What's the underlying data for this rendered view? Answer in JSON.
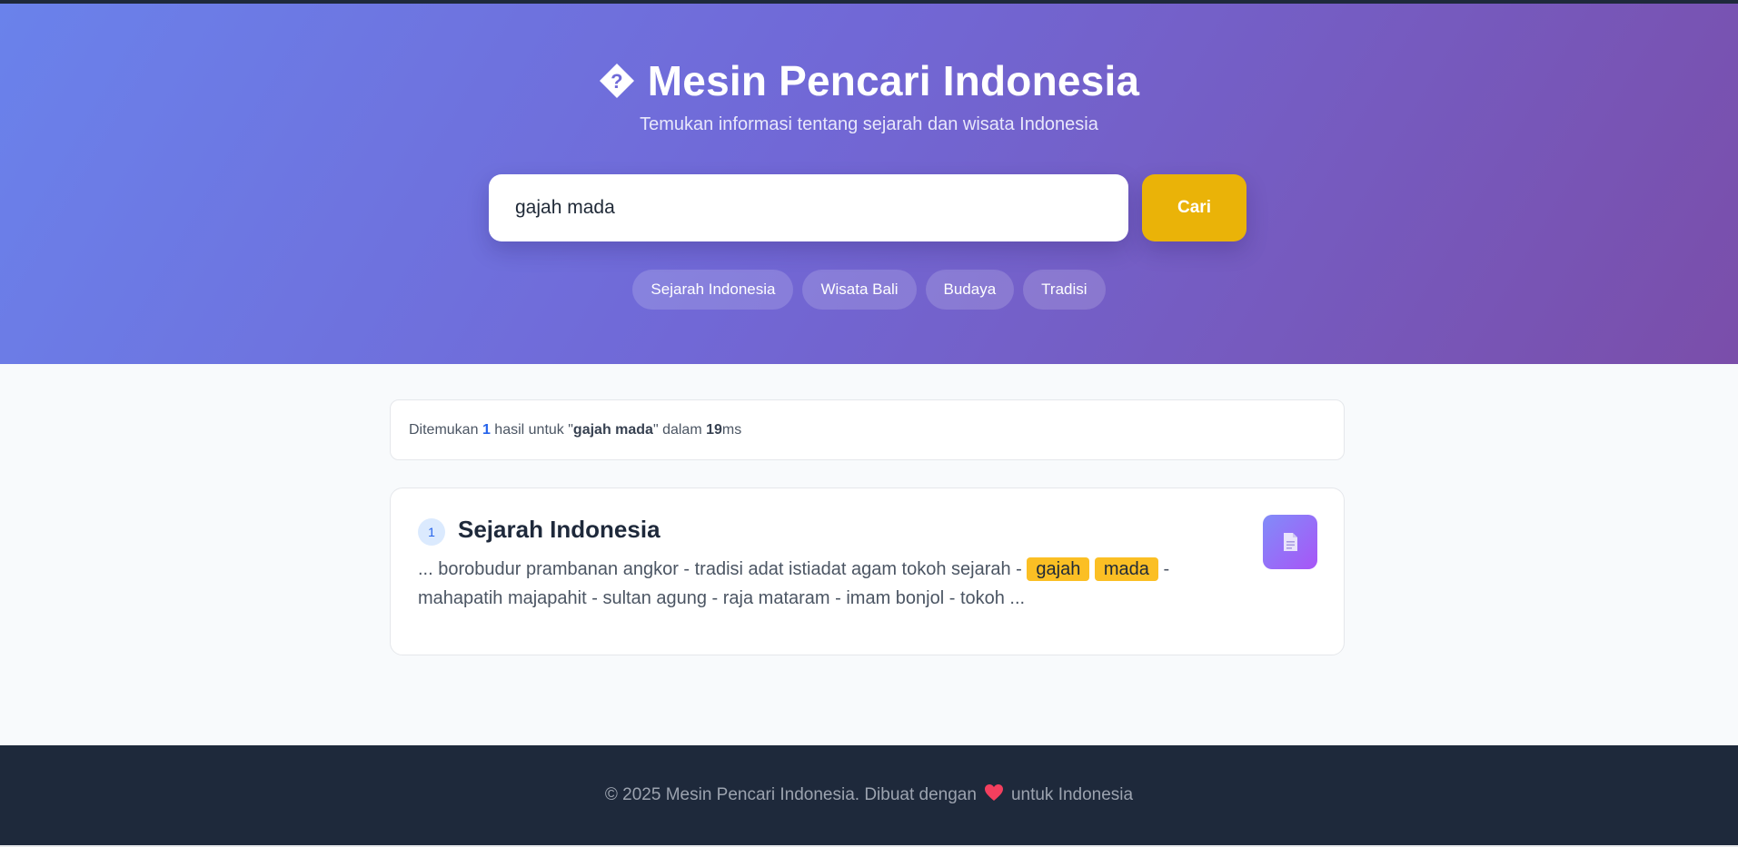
{
  "header": {
    "title": "Mesin Pencari Indonesia",
    "subtitle": "Temukan informasi tentang sejarah dan wisata Indonesia",
    "title_icon": "diamond-question-icon"
  },
  "search": {
    "value": "gajah mada",
    "button_label": "Cari"
  },
  "chips": [
    "Sejarah Indonesia",
    "Wisata Bali",
    "Budaya",
    "Tradisi"
  ],
  "stats": {
    "prefix": "Ditemukan",
    "count": "1",
    "middle": "hasil untuk \"",
    "query": "gajah mada",
    "after_query": "\" dalam",
    "time": "19",
    "unit": "ms"
  },
  "results": [
    {
      "rank": "1",
      "title": "Sejarah Indonesia",
      "snippet_before": "... borobudur prambanan angkor - tradisi adat istiadat agam tokoh sejarah -",
      "highlight_1": "gajah",
      "highlight_2": "mada",
      "snippet_after": "- mahapatih majapahit - sultan agung - raja mataram - imam bonjol - tokoh ...",
      "icon": "document-icon"
    }
  ],
  "footer": {
    "text_before": "© 2025 Mesin Pencari Indonesia. Dibuat dengan",
    "text_after": "untuk Indonesia",
    "icon": "heart-icon"
  },
  "colors": {
    "accent": "#eab308",
    "highlight": "#fbbf24",
    "link": "#2563eb",
    "footer_bg": "#1e293b"
  }
}
